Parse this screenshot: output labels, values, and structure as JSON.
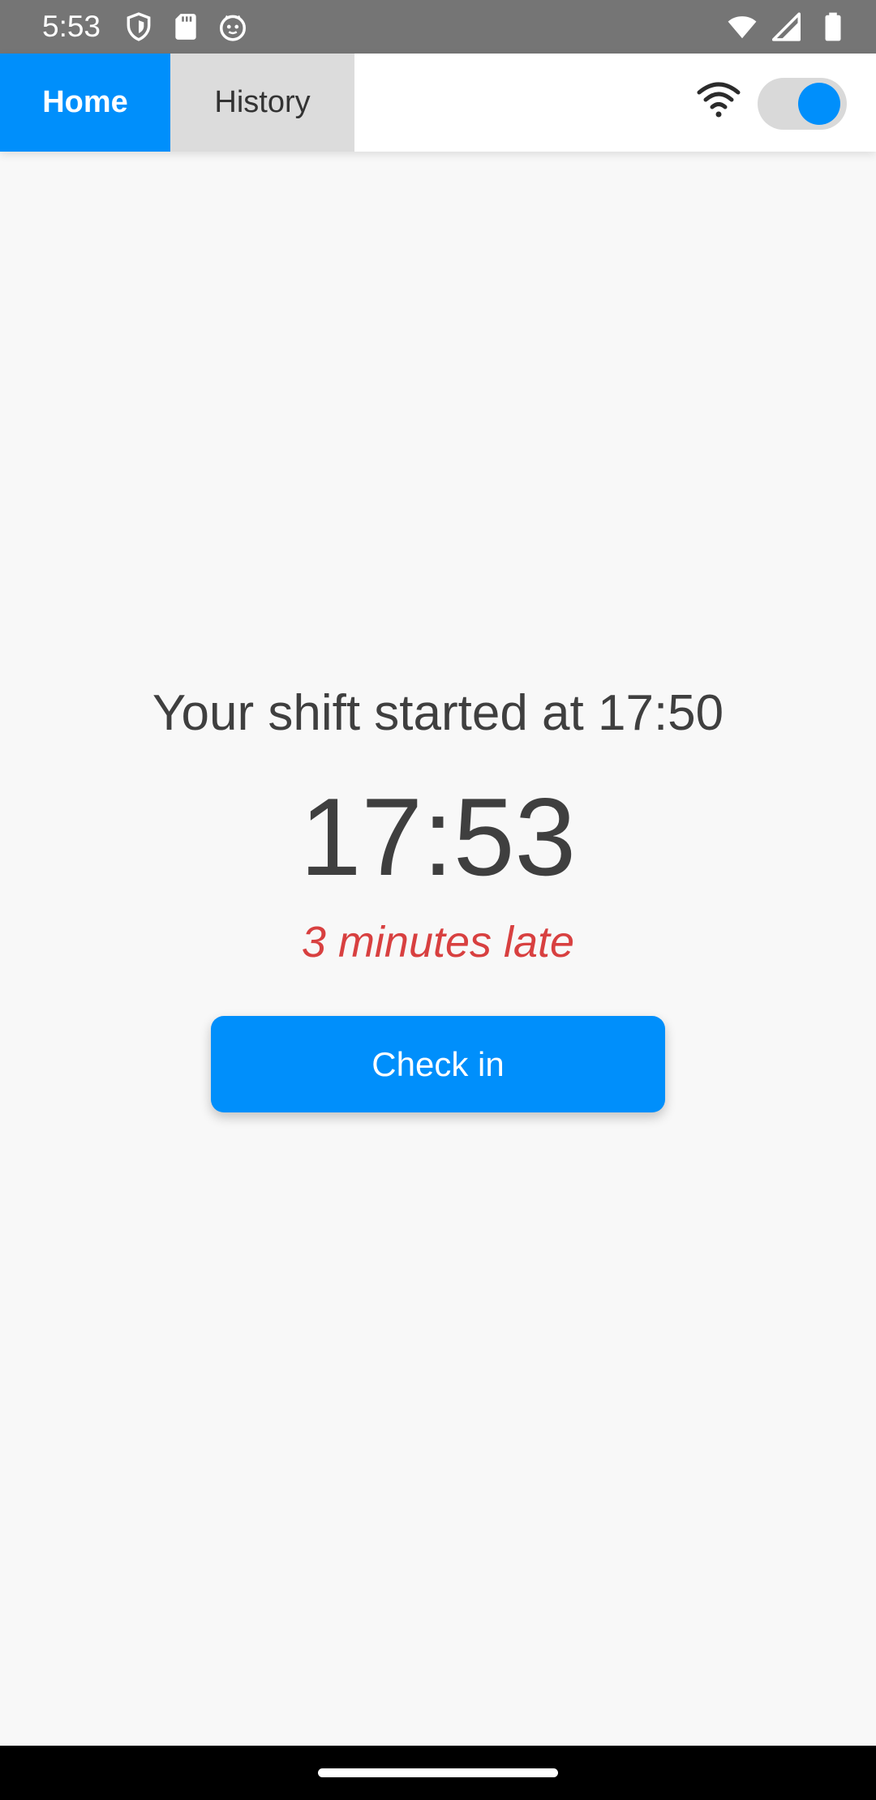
{
  "status_bar": {
    "time": "5:53",
    "left_icons": [
      "shield-icon",
      "sd-card-icon",
      "cat-face-icon"
    ],
    "right_icons": [
      "wifi-signal-icon",
      "cell-signal-icon",
      "battery-icon"
    ]
  },
  "app_bar": {
    "tabs": [
      {
        "label": "Home",
        "selected": true
      },
      {
        "label": "History",
        "selected": false
      }
    ],
    "wifi_icon": "wifi-icon",
    "toggle_on": true
  },
  "main": {
    "shift_text": "Your shift started at 17:50",
    "clock": "17:53",
    "late_text": "3 minutes late",
    "checkin_label": "Check in"
  },
  "colors": {
    "accent": "#008ffb",
    "late": "#d84040",
    "text": "#3f3f3f",
    "status_bar": "#757575",
    "background": "#f8f8f8"
  }
}
